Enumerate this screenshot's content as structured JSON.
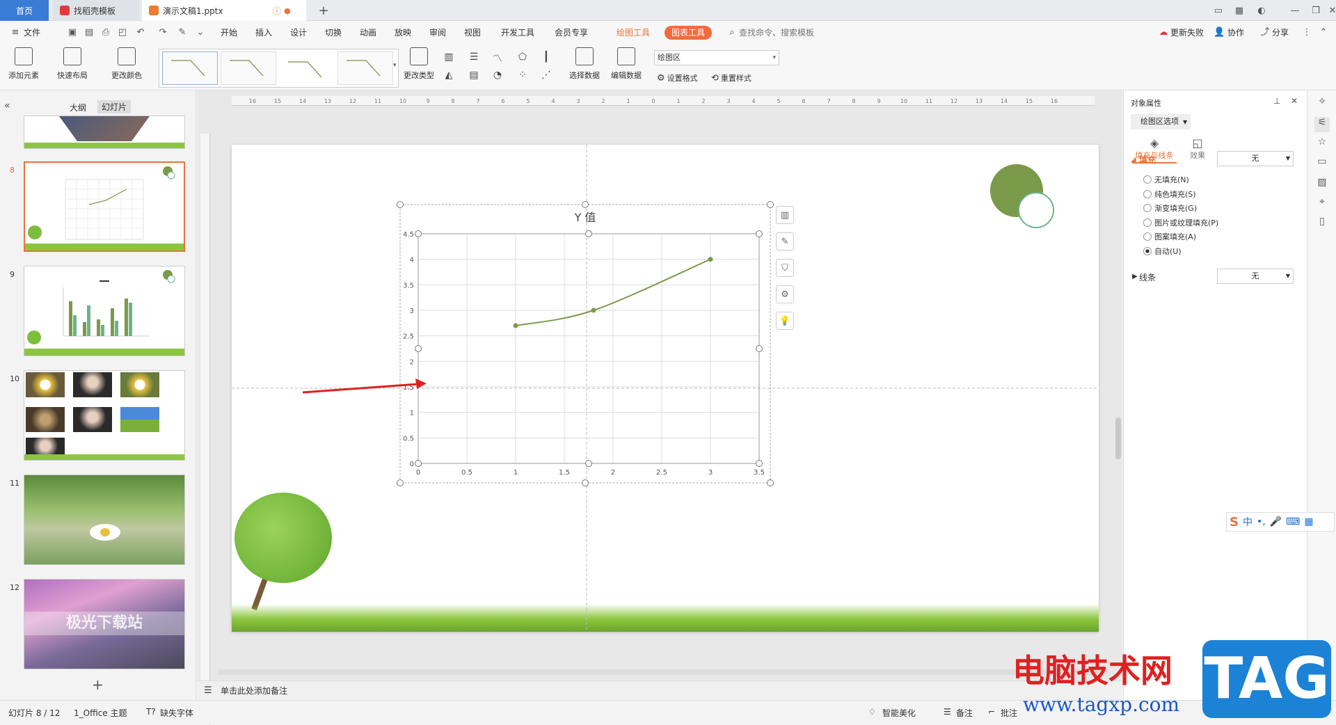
{
  "tabs": {
    "home": "首页",
    "template": "找稻壳模板",
    "document": "演示文稿1.pptx"
  },
  "menu": {
    "file": "文件",
    "items": [
      "开始",
      "插入",
      "设计",
      "切换",
      "动画",
      "放映",
      "审阅",
      "视图",
      "开发工具",
      "会员专享"
    ],
    "drawing_tools": "绘图工具",
    "chart_tools": "图表工具",
    "search_placeholder": "查找命令、搜索模板",
    "update_failed": "更新失败",
    "collaborate": "协作",
    "share": "分享"
  },
  "ribbon": {
    "add_element": "添加元素",
    "quick_layout": "快速布局",
    "change_color": "更改颜色",
    "change_type": "更改类型",
    "select_data": "选择数据",
    "edit_data": "编辑数据",
    "area_combo": "绘图区",
    "set_format": "设置格式",
    "reset_style": "重置样式"
  },
  "left_panel": {
    "outline_tab": "大纲",
    "slides_tab": "幻灯片",
    "slide_numbers": [
      "8",
      "9",
      "10",
      "11",
      "12"
    ],
    "slide12_caption": "极光下载站"
  },
  "chart_data": {
    "type": "scatter",
    "title": "Y 值",
    "x": [
      1,
      1.8,
      3
    ],
    "y": [
      2.7,
      3,
      4
    ],
    "xlim": [
      0,
      3.5
    ],
    "ylim": [
      0,
      4.5
    ],
    "xticks": [
      "0",
      "0.5",
      "1",
      "1.5",
      "2",
      "2.5",
      "3",
      "3.5"
    ],
    "yticks": [
      "0",
      "0.5",
      "1",
      "1.5",
      "2",
      "2.5",
      "3",
      "3.5",
      "4",
      "4.5"
    ],
    "line_color": "#7a9a4a",
    "grid": true,
    "smooth": true
  },
  "ruler_labels": [
    "16",
    "15",
    "14",
    "13",
    "12",
    "11",
    "10",
    "9",
    "8",
    "7",
    "6",
    "5",
    "4",
    "3",
    "2",
    "1",
    "0",
    "1",
    "2",
    "3",
    "4",
    "5",
    "6",
    "7",
    "8",
    "9",
    "10",
    "11",
    "12",
    "13",
    "14",
    "15",
    "16"
  ],
  "notes": {
    "placeholder": "单击此处添加备注"
  },
  "right_panel": {
    "header": "对象属性",
    "subheader": "绘图区选项",
    "tab_fill_line": "填充与线条",
    "tab_effect": "效果",
    "fill_label": "填充",
    "fill_value": "无",
    "fill_options": [
      "无填充(N)",
      "纯色填充(S)",
      "渐变填充(G)",
      "图片或纹理填充(P)",
      "图案填充(A)",
      "自动(U)"
    ],
    "selected_fill_index": 5,
    "line_label": "线条",
    "line_value": "无"
  },
  "status": {
    "slide_counter": "幻灯片 8 / 12",
    "theme": "1_Office 主题",
    "missing_font": "缺失字体",
    "smart_beautify": "智能美化",
    "notes": "备注",
    "comments": "批注"
  },
  "ime": {
    "lang": "中"
  },
  "watermark": {
    "site_name": "电脑技术网",
    "url": "www.tagxp.com",
    "tag": "TAG"
  },
  "colors": {
    "accent_orange": "#e8743b",
    "chart_tools_pill": "#f36b3c",
    "home_tab": "#3a7bd5",
    "arrow_red": "#e02020"
  }
}
